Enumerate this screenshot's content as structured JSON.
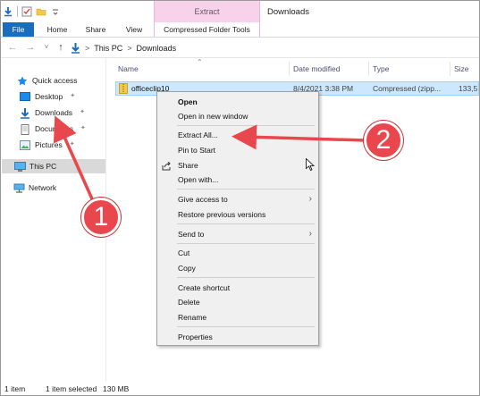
{
  "ribbon": {
    "context_group": "Extract",
    "window_title": "Downloads",
    "tabs": {
      "file": "File",
      "home": "Home",
      "share": "Share",
      "view": "View",
      "compressed_tools": "Compressed Folder Tools"
    }
  },
  "address": {
    "segments": [
      "This PC",
      "Downloads"
    ],
    "separator": ">"
  },
  "nav": {
    "quick_access": "Quick access",
    "items": [
      "Desktop",
      "Downloads",
      "Documents",
      "Pictures"
    ],
    "this_pc": "This PC",
    "network": "Network"
  },
  "columns": {
    "name": "Name",
    "date": "Date modified",
    "type": "Type",
    "size": "Size"
  },
  "file": {
    "name": "officeclip10",
    "date": "8/4/2021 3:38 PM",
    "type": "Compressed (zipp...",
    "size": "133,5"
  },
  "context_menu": {
    "open": "Open",
    "open_new_window": "Open in new window",
    "extract_all": "Extract All...",
    "pin_to_start": "Pin to Start",
    "share": "Share",
    "open_with": "Open with...",
    "give_access": "Give access to",
    "restore_versions": "Restore previous versions",
    "send_to": "Send to",
    "cut": "Cut",
    "copy": "Copy",
    "create_shortcut": "Create shortcut",
    "delete": "Delete",
    "rename": "Rename",
    "properties": "Properties"
  },
  "status": {
    "count": "1 item",
    "selected": "1 item selected",
    "size": "130 MB"
  },
  "annotations": {
    "badge1": "1",
    "badge2": "2"
  },
  "colors": {
    "accent": "#1a6cbf",
    "context_tab": "#f7d2ea",
    "selection": "#cce8ff",
    "annotation": "#e8484d"
  }
}
